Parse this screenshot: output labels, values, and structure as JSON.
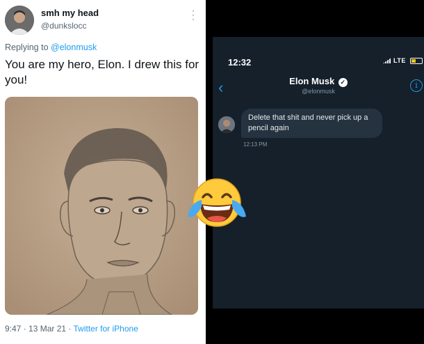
{
  "tweet": {
    "display_name": "smh my head",
    "handle": "@dunkslocc",
    "replying_prefix": "Replying to ",
    "replying_to": "@elonmusk",
    "text": "You are my hero, Elon. I drew this for you!",
    "time_date": "9:47 · 13 Mar 21 · ",
    "source": "Twitter for iPhone",
    "more_icon": "more-vertical-icon"
  },
  "dm": {
    "status_time": "12:32",
    "network": "LTE",
    "contact_name": "Elon Musk",
    "contact_handle": "@elonmusk",
    "message": "Delete that shit and never pick up a pencil again",
    "message_time": "12:13 PM"
  },
  "emoji": "face-with-tears-of-joy",
  "colors": {
    "link_blue": "#1d9bf0",
    "dm_background": "#15202b",
    "bubble": "#253341"
  }
}
